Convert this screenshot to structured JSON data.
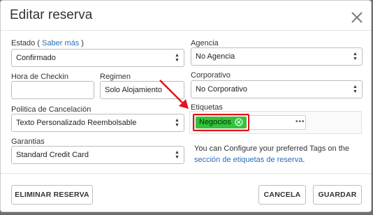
{
  "dialog": {
    "title": "Editar reserva",
    "close_label": "×"
  },
  "estado": {
    "label": "Estado (",
    "link": "Saber más",
    "label_end": ")",
    "value": "Confirmado"
  },
  "agencia": {
    "label": "Agencia",
    "value": "No Agencia"
  },
  "checkin": {
    "label": "Hora de Checkin",
    "value": ""
  },
  "regimen": {
    "label": "Regimen",
    "value": "Solo Alojamiento"
  },
  "corporativo": {
    "label": "Corporativo",
    "value": "No Corporativo"
  },
  "politica": {
    "label": "Politica de Cancelación",
    "value": "Texto Personalizado Reembolsable"
  },
  "etiquetas": {
    "label": "Etiquetas",
    "tags": [
      "Negocios"
    ],
    "more": "•••",
    "info_text": "You can Configure your preferred Tags on the",
    "info_link": "sección de etiquetas de reserva",
    "info_end": "."
  },
  "garantias": {
    "label": "Garantias",
    "value": "Standard Credit Card"
  },
  "footer": {
    "delete_label": "ELIMINAR RESERVA",
    "cancel_label": "CANCELA",
    "save_label": "GUARDAR"
  },
  "colors": {
    "tag_green": "#34c33a",
    "highlight_red": "#e8111b",
    "link_blue": "#2a6ebb"
  }
}
